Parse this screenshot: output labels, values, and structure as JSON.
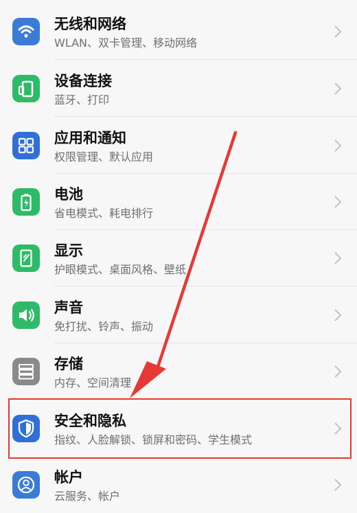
{
  "settings": {
    "items": [
      {
        "title": "无线和网络",
        "subtitle": "WLAN、双卡管理、移动网络",
        "icon": "wifi-icon",
        "color": "#3a7bd5"
      },
      {
        "title": "设备连接",
        "subtitle": "蓝牙、打印",
        "icon": "device-connect-icon",
        "color": "#2fba6a"
      },
      {
        "title": "应用和通知",
        "subtitle": "权限管理、默认应用",
        "icon": "apps-grid-icon",
        "color": "#2f6fd6"
      },
      {
        "title": "电池",
        "subtitle": "省电模式、耗电排行",
        "icon": "battery-icon",
        "color": "#2fba6a"
      },
      {
        "title": "显示",
        "subtitle": "护眼模式、桌面风格、壁纸",
        "icon": "display-icon",
        "color": "#2fba6a"
      },
      {
        "title": "声音",
        "subtitle": "免打扰、铃声、振动",
        "icon": "sound-icon",
        "color": "#2fba6a"
      },
      {
        "title": "存储",
        "subtitle": "内存、空间清理",
        "icon": "storage-icon",
        "color": "#8a8a8a"
      },
      {
        "title": "安全和隐私",
        "subtitle": "指纹、人脸解锁、锁屏和密码、学生模式",
        "icon": "shield-icon",
        "color": "#2f6fd6"
      },
      {
        "title": "帐户",
        "subtitle": "云服务、帐户",
        "icon": "account-icon",
        "color": "#3a7bd5"
      }
    ]
  },
  "annotation": {
    "highlight_color": "#e53935",
    "highlighted_item": "安全和隐私"
  }
}
